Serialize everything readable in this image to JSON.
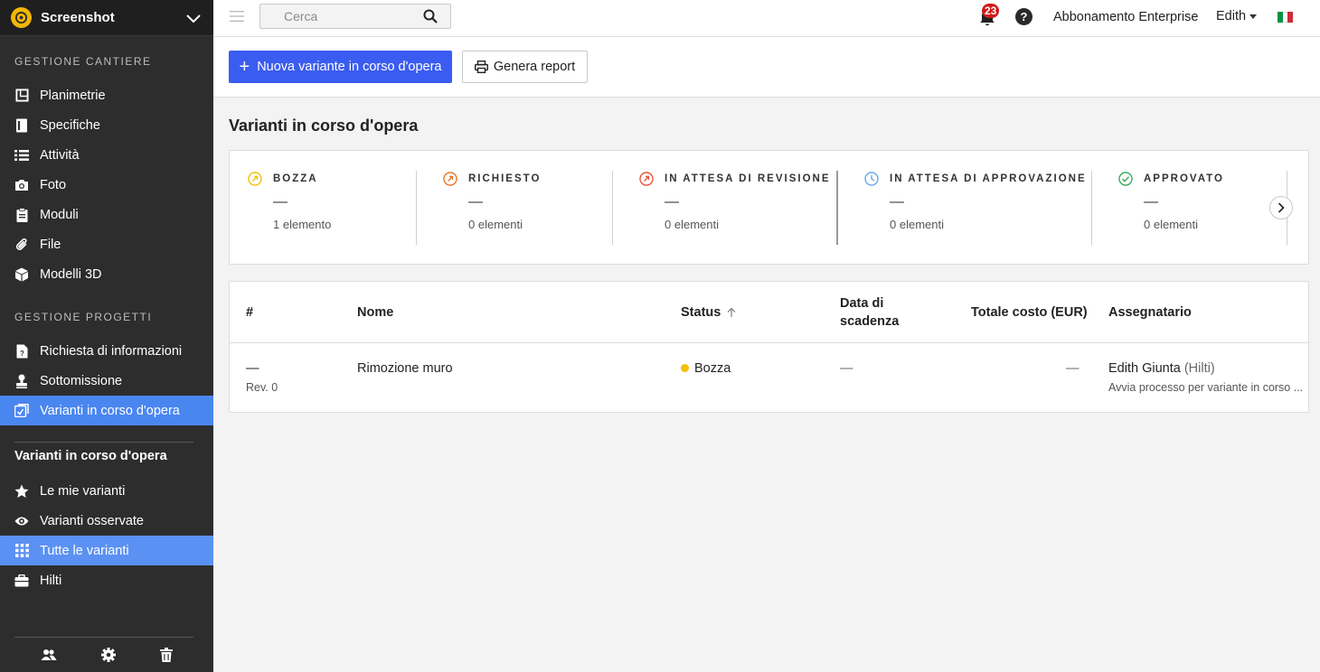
{
  "sidebar": {
    "app_title": "Screenshot",
    "sections": [
      {
        "title": "GESTIONE CANTIERE",
        "items": [
          {
            "label": "Planimetrie",
            "icon": "floorplan-icon"
          },
          {
            "label": "Specifiche",
            "icon": "book-icon"
          },
          {
            "label": "Attività",
            "icon": "list-icon"
          },
          {
            "label": "Foto",
            "icon": "camera-icon"
          },
          {
            "label": "Moduli",
            "icon": "clipboard-icon"
          },
          {
            "label": "File",
            "icon": "paperclip-icon"
          },
          {
            "label": "Modelli 3D",
            "icon": "cube-icon"
          }
        ]
      },
      {
        "title": "GESTIONE PROGETTI",
        "items": [
          {
            "label": "Richiesta di informazioni",
            "icon": "rfi-icon"
          },
          {
            "label": "Sottomissione",
            "icon": "stamp-icon"
          },
          {
            "label": "Varianti in corso d'opera",
            "icon": "change-order-icon",
            "active": true
          }
        ]
      }
    ],
    "subnav": {
      "title": "Varianti in corso d'opera",
      "items": [
        {
          "label": "Le mie varianti",
          "icon": "star-icon"
        },
        {
          "label": "Varianti osservate",
          "icon": "eye-icon"
        },
        {
          "label": "Tutte le varianti",
          "icon": "grid-icon",
          "active": true
        },
        {
          "label": "Hilti",
          "icon": "briefcase-icon"
        }
      ]
    },
    "bottom_icons": [
      "users-icon",
      "gear-icon",
      "trash-icon"
    ]
  },
  "topbar": {
    "search_placeholder": "Cerca",
    "notifications_count": "23",
    "help_label": "?",
    "subscription": "Abbonamento Enterprise",
    "user": "Edith",
    "flag_colors": [
      "#009246",
      "#ffffff",
      "#ce2b37"
    ]
  },
  "actions": {
    "new_label": "Nuova variante in corso d'opera",
    "report_label": "Genera report"
  },
  "page": {
    "title": "Varianti in corso d'opera"
  },
  "statuses": [
    {
      "label": "BOZZA",
      "value": "—",
      "count": "1 elemento",
      "color": "#f4c00c"
    },
    {
      "label": "RICHIESTO",
      "value": "—",
      "count": "0 elementi",
      "color": "#e8772e"
    },
    {
      "label": "IN ATTESA DI REVISIONE",
      "value": "—",
      "count": "0 elementi",
      "color": "#e5553a"
    },
    {
      "label": "IN ATTESA DI APPROVAZIONE",
      "value": "—",
      "count": "0 elementi",
      "color": "#6aa9e8"
    },
    {
      "label": "APPROVATO",
      "value": "—",
      "count": "0 elementi",
      "color": "#3aab5b"
    }
  ],
  "table": {
    "headers": {
      "num": "#",
      "name": "Nome",
      "status": "Status",
      "due_line1": "Data di",
      "due_line2": "scadenza",
      "cost": "Totale costo (EUR)",
      "assignee": "Assegnatario"
    },
    "rows": [
      {
        "num": "—",
        "rev": "Rev. 0",
        "name": "Rimozione muro",
        "status": "Bozza",
        "due": "—",
        "cost": "—",
        "assignee": "Edith Giunta",
        "assignee_org": "(Hilti)",
        "assignee_note": "Avvia processo per variante in corso ..."
      }
    ]
  }
}
